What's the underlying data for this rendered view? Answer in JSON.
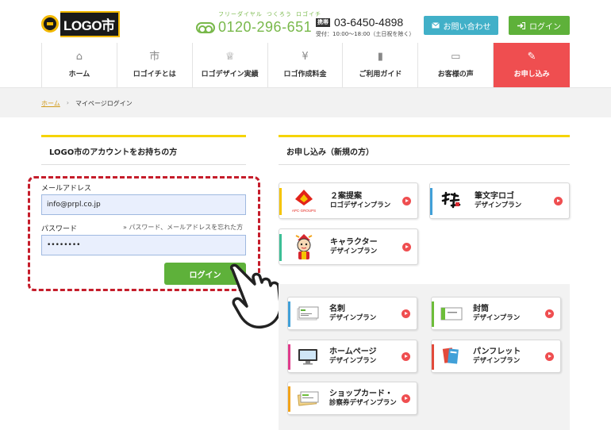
{
  "header": {
    "logo_text": "LOGO市",
    "freedial_kana": [
      "フリーダイヤル",
      "つくろう",
      "ロゴイチ"
    ],
    "freedial_number": "0120-296-651",
    "phone_badge": "携帯",
    "phone_number": "03-6450-4898",
    "phone_hours": "受付：10:00〜18:00（土日祝を除く）",
    "contact_label": "お問い合わせ",
    "login_label": "ログイン"
  },
  "nav": {
    "items": [
      {
        "label": "ホーム",
        "icon": "home-icon"
      },
      {
        "label": "ロゴイチとは",
        "icon": "ichi-icon"
      },
      {
        "label": "ロゴデザイン実績",
        "icon": "trophy-icon"
      },
      {
        "label": "ロゴ作成料金",
        "icon": "yen-icon"
      },
      {
        "label": "ご利用ガイド",
        "icon": "bookmark-icon"
      },
      {
        "label": "お客様の声",
        "icon": "speech-icon"
      },
      {
        "label": "お申し込み",
        "icon": "edit-icon"
      }
    ],
    "active_color": "#ef4e50"
  },
  "breadcrumb": {
    "home": "ホーム",
    "separator": "›",
    "current": "マイページログイン"
  },
  "login": {
    "title": "LOGO市のアカウントをお持ちの方",
    "email_label": "メールアドレス",
    "email_value": "info@prpl.co.jp",
    "password_label": "パスワード",
    "forgot_link": "» パスワード、メールアドレスを忘れた方",
    "password_value": "••••••••",
    "submit_label": "ログイン"
  },
  "apply": {
    "title": "お申し込み（新規の方）",
    "plans": [
      {
        "line1": "２案提案",
        "line2": "ロゴデザインプラン",
        "accent": "#f5c400"
      },
      {
        "line1": "筆文字ロゴ",
        "line2": "デザインプラン",
        "accent": "#41a0d8"
      },
      {
        "line1": "キャラクター",
        "line2": "デザインプラン",
        "accent": "#3cbf96"
      }
    ],
    "thumb_caption": "APC·GROUPS",
    "sub_plans": [
      {
        "line1": "名刺",
        "line2": "デザインプラン",
        "accent": "#41a0d8"
      },
      {
        "line1": "封筒",
        "line2": "デザインプラン",
        "accent": "#6dbd3a"
      },
      {
        "line1": "ホームページ",
        "line2": "デザインプラン",
        "accent": "#e03c8c"
      },
      {
        "line1": "パンフレット",
        "line2": "デザインプラン",
        "accent": "#e24a3b"
      },
      {
        "line1": "ショップカード・",
        "line2": "診察券デザインプラン",
        "accent": "#f2a31a"
      }
    ]
  }
}
